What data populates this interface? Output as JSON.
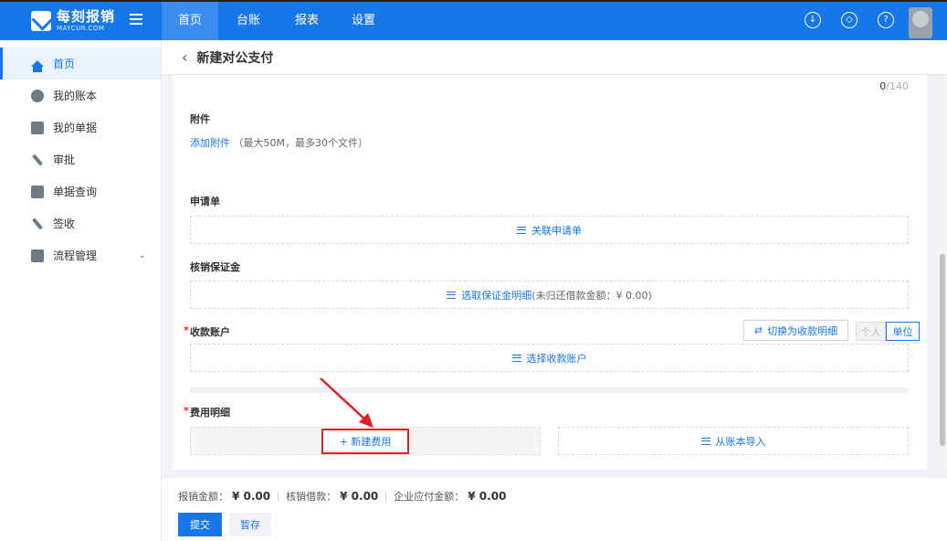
{
  "brand": {
    "name_cn": "每刻报销",
    "name_en": "MAYCUR.COM"
  },
  "topnav": {
    "tabs": [
      "首页",
      "台账",
      "报表",
      "设置"
    ],
    "active": 0
  },
  "topicons": [
    "download-icon",
    "cube-icon",
    "help-icon"
  ],
  "sidebar": {
    "items": [
      {
        "label": "首页",
        "icon": "home-icon",
        "active": true
      },
      {
        "label": "我的账本",
        "icon": "ledger-icon"
      },
      {
        "label": "我的单据",
        "icon": "document-icon"
      },
      {
        "label": "审批",
        "icon": "pen-icon"
      },
      {
        "label": "单据查询",
        "icon": "search-doc-icon"
      },
      {
        "label": "签收",
        "icon": "sign-icon"
      },
      {
        "label": "流程管理",
        "icon": "flow-icon",
        "expandable": true
      }
    ]
  },
  "header": {
    "title": "新建对公支付"
  },
  "form": {
    "counter_current": "0",
    "counter_max": "/140",
    "attachment": {
      "label": "附件",
      "link": "添加附件",
      "hint": "（最大50M，最多30个文件）"
    },
    "application": {
      "label": "申请单",
      "action": "关联申请单"
    },
    "deposit": {
      "label": "核销保证金",
      "action": "选取保证金明细",
      "note": "(未归还借款金额：¥ 0.00)"
    },
    "account": {
      "label": "收款账户",
      "switch_label": "切换为收款明细",
      "seg_personal": "个人",
      "seg_unit": "单位",
      "action": "选择收款账户"
    },
    "expense": {
      "label": "费用明细",
      "new_label": "新建费用",
      "import_label": "从账本导入"
    }
  },
  "footer": {
    "reimburse_label": "报销金额：",
    "reimburse_value": "¥ 0.00",
    "writeoff_label": "核销借款：",
    "writeoff_value": "¥ 0.00",
    "payable_label": "企业应付金额：",
    "payable_value": "¥ 0.00",
    "submit": "提交",
    "draft": "暂存"
  },
  "colors": {
    "primary": "#1677e8",
    "highlight": "#e02020"
  }
}
